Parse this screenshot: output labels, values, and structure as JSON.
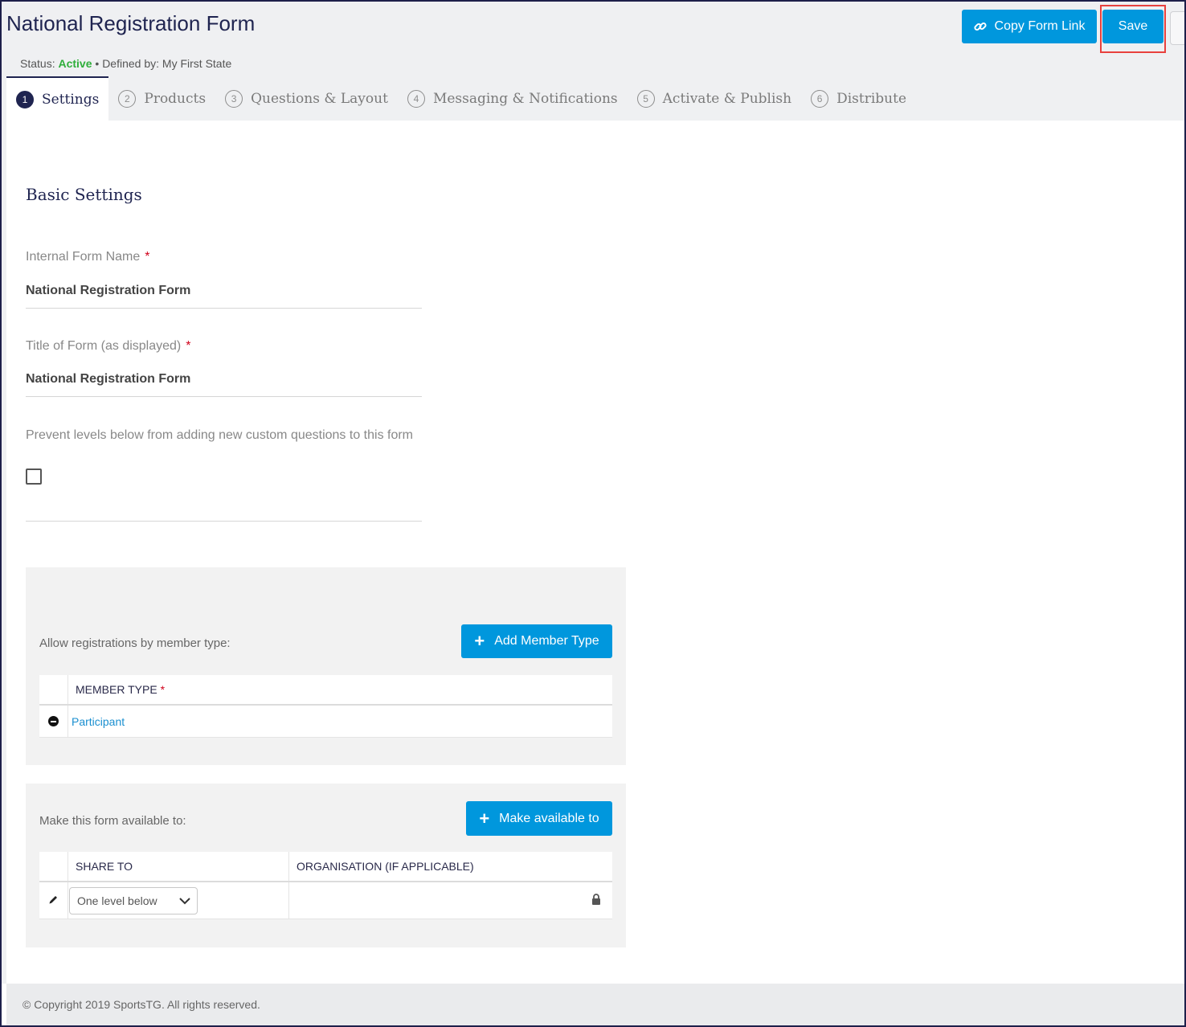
{
  "page": {
    "title": "National Registration Form",
    "status_label": "Status:",
    "status_value": "Active",
    "defined_by": "• Defined by: My First State"
  },
  "colors": {
    "accent": "#0097dd",
    "navy": "#1f2450",
    "status_active": "#2fae3b",
    "required": "#d0021b",
    "highlight": "#e8413e"
  },
  "toolbar": {
    "copy_label": "Copy Form Link",
    "copy_icon": "link-icon",
    "save_label": "Save"
  },
  "tabs": [
    {
      "num": "1",
      "label": "Settings",
      "active": true
    },
    {
      "num": "2",
      "label": "Products",
      "active": false
    },
    {
      "num": "3",
      "label": "Questions & Layout",
      "active": false
    },
    {
      "num": "4",
      "label": "Messaging & Notifications",
      "active": false
    },
    {
      "num": "5",
      "label": "Activate & Publish",
      "active": false
    },
    {
      "num": "6",
      "label": "Distribute",
      "active": false
    }
  ],
  "basic": {
    "section_title": "Basic Settings",
    "internal_name_label": "Internal Form Name",
    "internal_name_value": "National Registration Form",
    "title_label": "Title of Form (as displayed)",
    "title_value": "National Registration Form",
    "required_mark": "*",
    "prevent_label": "Prevent levels below from adding new custom questions to this form",
    "prevent_checked": false
  },
  "member_types": {
    "label": "Allow registrations by member type:",
    "button_label": "Add Member Type",
    "column": "MEMBER TYPE",
    "rows": [
      {
        "value": "Participant"
      }
    ]
  },
  "availability": {
    "label": "Make this form available to:",
    "button_label": "Make available to",
    "columns": [
      "SHARE TO",
      "ORGANISATION (IF APPLICABLE)"
    ],
    "rows": [
      {
        "share_to": "One level below",
        "organisation": ""
      }
    ]
  },
  "footer": {
    "copyright": "© Copyright 2019 SportsTG. All rights reserved."
  }
}
